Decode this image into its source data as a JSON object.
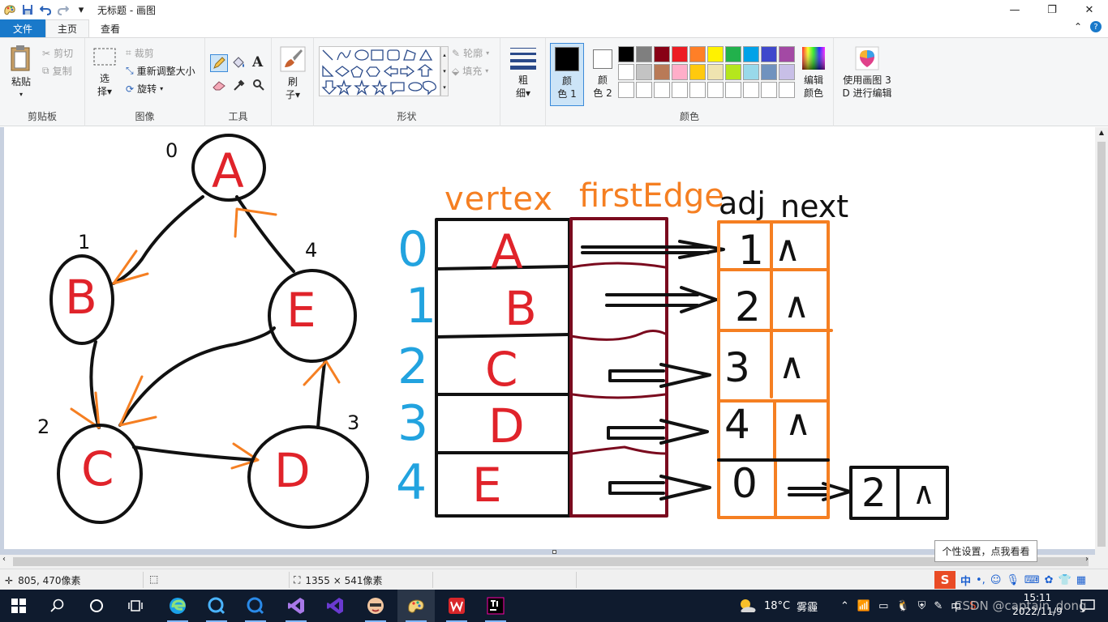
{
  "window": {
    "title": "无标题 - 画图",
    "controls": {
      "minimize": "—",
      "maximize": "❐",
      "close": "✕"
    }
  },
  "quick_access": {
    "dropdown": "▾"
  },
  "tabs": [
    {
      "label": "文件"
    },
    {
      "label": "主页"
    },
    {
      "label": "查看"
    }
  ],
  "ribbon_controls": {
    "collapse": "⌃",
    "help": "?"
  },
  "ribbon": {
    "clipboard": {
      "label": "剪贴板",
      "paste": "粘贴",
      "cut": "剪切",
      "copy": "复制"
    },
    "image": {
      "label": "图像",
      "select": "选",
      "select2": "择",
      "crop": "裁剪",
      "resize": "重新调整大小",
      "rotate": "旋转"
    },
    "tools": {
      "label": "工具",
      "text_tool": "A"
    },
    "brush": {
      "label1": "刷",
      "label2": "子"
    },
    "shapes": {
      "label": "形状",
      "outline": "轮廓",
      "fill": "填充"
    },
    "size": {
      "label1": "粗",
      "label2": "细"
    },
    "color1": {
      "label1": "颜",
      "label2": "色 1"
    },
    "color2": {
      "label1": "颜",
      "label2": "色 2"
    },
    "colors": {
      "label": "颜色",
      "palette": [
        "#000000",
        "#7f7f7f",
        "#880015",
        "#ed1c24",
        "#ff7f27",
        "#fff200",
        "#22b14c",
        "#00a2e8",
        "#3f48cc",
        "#a349a4",
        "#ffffff",
        "#c3c3c3",
        "#b97a57",
        "#ffaec9",
        "#ffc90e",
        "#efe4b0",
        "#b5e61d",
        "#99d9ea",
        "#7092be",
        "#c8bfe7",
        "#ffffff",
        "#ffffff",
        "#ffffff",
        "#ffffff",
        "#ffffff",
        "#ffffff",
        "#ffffff",
        "#ffffff",
        "#ffffff",
        "#ffffff"
      ],
      "edit1": "编辑",
      "edit2": "颜色"
    },
    "paint3d": {
      "label1": "使用画图 3",
      "label2": "D 进行编辑"
    }
  },
  "drawing": {
    "nodes": [
      {
        "letter": "A",
        "index": "0"
      },
      {
        "letter": "B",
        "index": "1"
      },
      {
        "letter": "C",
        "index": "2"
      },
      {
        "letter": "D",
        "index": "3"
      },
      {
        "letter": "E",
        "index": "4"
      }
    ],
    "table_headers": {
      "vertex": "vertex",
      "first_edge": "firstEdge",
      "adj": "adj",
      "next": "next"
    },
    "table_rows": [
      {
        "index": "0",
        "vertex": "A",
        "adj": "1",
        "next": "∧"
      },
      {
        "index": "1",
        "vertex": "B",
        "adj": "2",
        "next": "∧"
      },
      {
        "index": "2",
        "vertex": "C",
        "adj": "3",
        "next": "∧"
      },
      {
        "index": "3",
        "vertex": "D",
        "adj": "4",
        "next": "∧"
      },
      {
        "index": "4",
        "vertex": "E",
        "adj": "0",
        "next": ""
      }
    ],
    "extra_node": {
      "adj": "2",
      "next": "∧"
    },
    "colors": {
      "ink": "#111111",
      "node_text": "#e0232a",
      "arrow": "#f57f22",
      "index": "#22a3df",
      "maroon": "#7a0a1e"
    }
  },
  "statusbar": {
    "position": "805, 470像素",
    "size": "1355 × 541像素"
  },
  "tooltip": "个性设置，点我看看",
  "ime": {
    "logo": "S",
    "mode": "中"
  },
  "taskbar": {
    "weather_temp": "18°C",
    "weather_desc": "雾霾",
    "time": "15:11",
    "date": "2022/11/9",
    "tray_text": "中"
  },
  "watermark": "CSDN @captain_dong"
}
